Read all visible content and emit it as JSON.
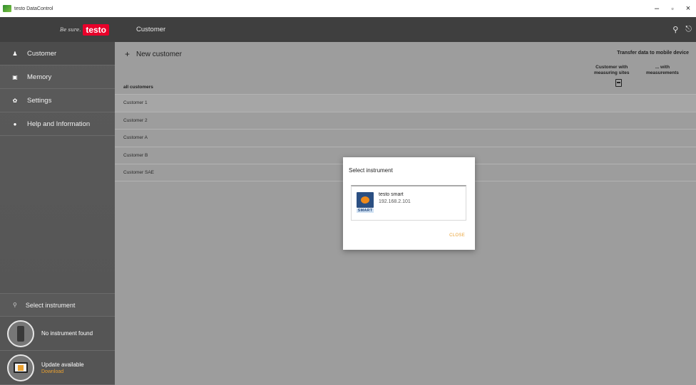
{
  "window": {
    "title": "testo DataControl",
    "controls": {
      "minimize": "–",
      "maximize": "▫",
      "close": "×"
    }
  },
  "brand": {
    "slogan": "Be sure.",
    "logo": "testo"
  },
  "sidebar": {
    "items": [
      {
        "label": "Customer",
        "icon": "person-icon",
        "glyph": "♟"
      },
      {
        "label": "Memory",
        "icon": "memory-icon",
        "glyph": "▣"
      },
      {
        "label": "Settings",
        "icon": "gear-icon",
        "glyph": "✿"
      },
      {
        "label": "Help and Information",
        "icon": "info-icon",
        "glyph": "●"
      }
    ],
    "select_instrument": {
      "label": "Select instrument",
      "glyph": "⚲"
    },
    "instrument_status": "No instrument found",
    "update": {
      "label": "Update available",
      "link": "Download"
    }
  },
  "header": {
    "title": "Customer"
  },
  "main": {
    "new_customer": "New customer",
    "transfer_title": "Transfer data to mobile device",
    "col_sites_line1": "Customer with",
    "col_sites_line2": "measuring sites",
    "col_meas_line1": "... with",
    "col_meas_line2": "measurements",
    "list_header": "all customers",
    "customers": [
      "Customer 1",
      "Customer 2",
      "Customer A",
      "Customer B",
      "Customer SAE"
    ]
  },
  "dialog": {
    "title": "Select instrument",
    "instrument_name": "testo smart",
    "instrument_ip": "192.168.2.101",
    "thumb_label": "SMART",
    "close_label": "CLOSE"
  },
  "colors": {
    "accent": "#e9a030",
    "brand_red": "#e8002a",
    "sidebar": "#555555",
    "header": "#3f3f3f",
    "content": "#9d9d9d"
  }
}
